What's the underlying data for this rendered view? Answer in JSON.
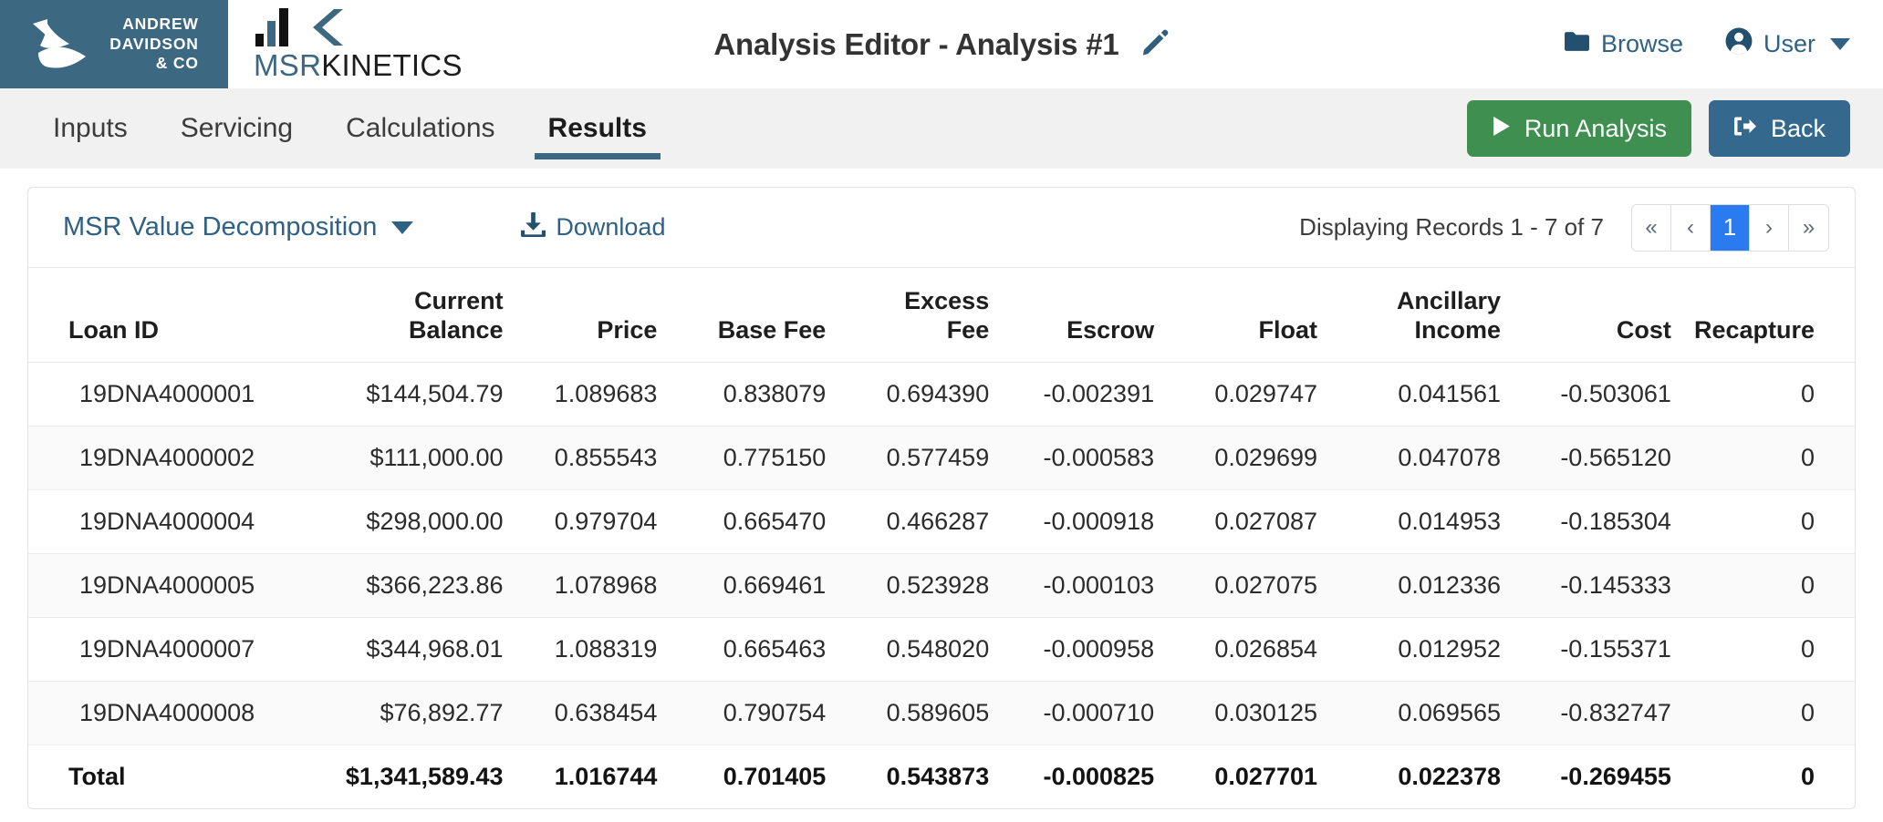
{
  "brand": {
    "company_line1": "ANDREW",
    "company_line2": "DAVIDSON",
    "company_line3": "& CO",
    "product_prefix": "MSR",
    "product_suffix": "KINETICS"
  },
  "header": {
    "title": "Analysis Editor - Analysis #1",
    "edit_icon": "pencil-icon",
    "browse_label": "Browse",
    "browse_icon": "folder-icon",
    "user_label": "User",
    "user_icon": "user-circle-icon",
    "user_caret_icon": "chevron-down-icon"
  },
  "tabs": [
    {
      "label": "Inputs",
      "active": false
    },
    {
      "label": "Servicing",
      "active": false
    },
    {
      "label": "Calculations",
      "active": false
    },
    {
      "label": "Results",
      "active": true
    }
  ],
  "actions": {
    "run_label": "Run Analysis",
    "run_icon": "play-icon",
    "run_color": "#3f8f51",
    "back_label": "Back",
    "back_icon": "sign-out-icon",
    "back_color": "#34688c"
  },
  "toolbar": {
    "report_label": "MSR Value Decomposition",
    "report_caret_icon": "chevron-down-icon",
    "download_label": "Download",
    "download_icon": "download-icon",
    "record_count": "Displaying Records 1 - 7 of 7",
    "pager": [
      {
        "label": "«",
        "name": "first",
        "active": false
      },
      {
        "label": "‹",
        "name": "prev",
        "active": false
      },
      {
        "label": "1",
        "name": "page-1",
        "active": true
      },
      {
        "label": "›",
        "name": "next",
        "active": false
      },
      {
        "label": "»",
        "name": "last",
        "active": false
      }
    ],
    "pager_active_color": "#2a7bf0"
  },
  "table": {
    "columns": [
      "Loan ID",
      "Current\nBalance",
      "Price",
      "Base Fee",
      "Excess\nFee",
      "Escrow",
      "Float",
      "Ancillary\nIncome",
      "Cost",
      "Recapture"
    ],
    "rows": [
      [
        "19DNA4000001",
        "$144,504.79",
        "1.089683",
        "0.838079",
        "0.694390",
        "-0.002391",
        "0.029747",
        "0.041561",
        "-0.503061",
        "0"
      ],
      [
        "19DNA4000002",
        "$111,000.00",
        "0.855543",
        "0.775150",
        "0.577459",
        "-0.000583",
        "0.029699",
        "0.047078",
        "-0.565120",
        "0"
      ],
      [
        "19DNA4000004",
        "$298,000.00",
        "0.979704",
        "0.665470",
        "0.466287",
        "-0.000918",
        "0.027087",
        "0.014953",
        "-0.185304",
        "0"
      ],
      [
        "19DNA4000005",
        "$366,223.86",
        "1.078968",
        "0.669461",
        "0.523928",
        "-0.000103",
        "0.027075",
        "0.012336",
        "-0.145333",
        "0"
      ],
      [
        "19DNA4000007",
        "$344,968.01",
        "1.088319",
        "0.665463",
        "0.548020",
        "-0.000958",
        "0.026854",
        "0.012952",
        "-0.155371",
        "0"
      ],
      [
        "19DNA4000008",
        "$76,892.77",
        "0.638454",
        "0.790754",
        "0.589605",
        "-0.000710",
        "0.030125",
        "0.069565",
        "-0.832747",
        "0"
      ]
    ],
    "total_row": [
      "Total",
      "$1,341,589.43",
      "1.016744",
      "0.701405",
      "0.543873",
      "-0.000825",
      "0.027701",
      "0.022378",
      "-0.269455",
      "0"
    ]
  },
  "colors": {
    "brand_teal": "#3d6882",
    "link_teal": "#2e6184",
    "tabbar_bg": "#f1f1f1"
  }
}
